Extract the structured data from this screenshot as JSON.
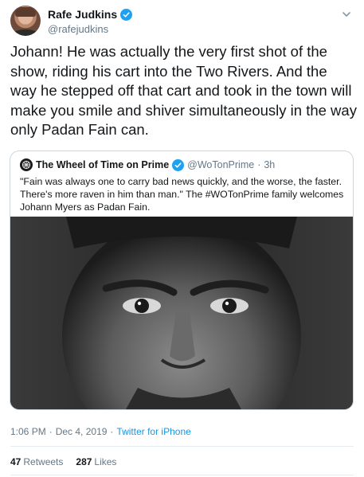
{
  "author": {
    "name": "Rafe Judkins",
    "handle": "@rafejudkins"
  },
  "tweet": {
    "text": "Johann! He was actually the very first shot of the show, riding his cart into the Two Rivers. And the way he stepped off that cart and took in the town will make you smile and shiver simultaneously in the way only Padan Fain can."
  },
  "quoted_tweet": {
    "name": "The Wheel of Time on Prime",
    "handle": "@WoTonPrime",
    "separator": "·",
    "time": "3h",
    "text": "\"Fain was always one to carry bad news quickly, and the worse, the faster. There's more raven in him than man.\"  The #WOTonPrime  family welcomes Johann Myers as Padan Fain."
  },
  "meta": {
    "time": "1:06 PM",
    "separator1": "·",
    "date": "Dec 4, 2019",
    "separator2": "·",
    "source": "Twitter for iPhone"
  },
  "stats": {
    "retweets_count": "47",
    "retweets_label": "Retweets",
    "likes_count": "287",
    "likes_label": "Likes"
  },
  "colors": {
    "verified": "#1da1f2",
    "link": "#1b95e0",
    "secondary_text": "#657786",
    "border": "#ccd6dd"
  },
  "icons": [
    "verified-badge-icon",
    "chevron-down-icon",
    "wheel-of-time-logo-icon"
  ]
}
